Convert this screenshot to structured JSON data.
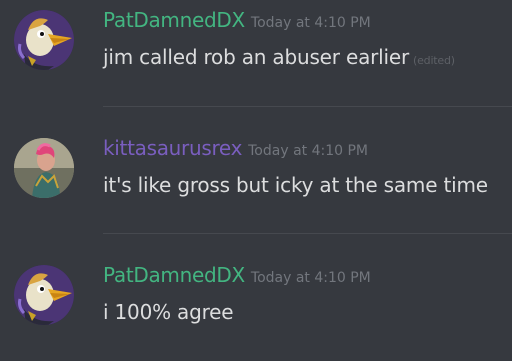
{
  "colors": {
    "background": "#36393f",
    "username_green": "#43b581",
    "username_purple": "#7a5ebf",
    "timestamp": "#72767d",
    "message_text": "#dcddde"
  },
  "messages": [
    {
      "username": "PatDamnedDX",
      "username_color": "#43b581",
      "timestamp": "Today at 4:10 PM",
      "text": "jim called rob an abuser earlier",
      "edited": "(edited)",
      "avatar_icon": "cartoon-bird-avatar"
    },
    {
      "username": "kittasaurusrex",
      "username_color": "#7a5ebf",
      "timestamp": "Today at 4:10 PM",
      "text": "it's like gross but icky at the same time",
      "avatar_icon": "photo-avatar"
    },
    {
      "username": "PatDamnedDX",
      "username_color": "#43b581",
      "timestamp": "Today at 4:10 PM",
      "text": "i 100% agree",
      "avatar_icon": "cartoon-bird-avatar"
    }
  ]
}
